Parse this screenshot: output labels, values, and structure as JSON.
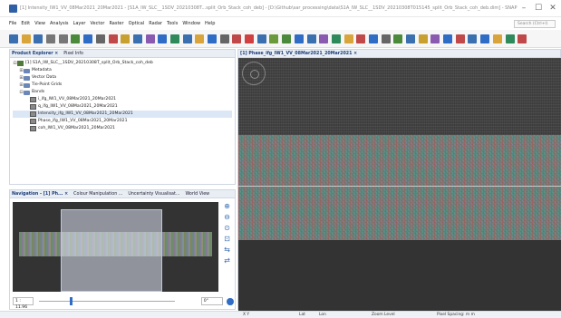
{
  "window": {
    "title": "[1] Intensity_IW1_VV_08Mar2021_20Mar2021 - [S1A_IW_SLC__1SDV_20210308T...split_Orb_Stack_coh_deb] - [D:\\Github\\sar_processing\\data\\S1A_IW_SLC__1SDV_20210308T015145_split_Orb_Stack_coh_deb.dim] - SNAP",
    "min": "–",
    "max": "☐",
    "close": "✕"
  },
  "menu": {
    "items": [
      "File",
      "Edit",
      "View",
      "Analysis",
      "Layer",
      "Vector",
      "Raster",
      "Optical",
      "Radar",
      "Tools",
      "Window",
      "Help"
    ],
    "search_placeholder": "Search (Ctrl+I)"
  },
  "toolbar": {
    "icons": [
      "new-product-icon",
      "open-icon",
      "save-icon",
      "undo-icon",
      "redo-icon",
      "zoom-tool-icon",
      "pan-tool-icon",
      "select-tool-icon",
      "range-finder-icon",
      "color-manip-icon",
      "layer-icon",
      "mask-icon",
      "histogram-icon",
      "scatter-icon",
      "profile-icon",
      "spectrum-icon",
      "info-icon",
      "statistics-icon",
      "gcp-icon",
      "pin-icon",
      "graph-builder-icon",
      "batch-icon",
      "band-maths-icon",
      "resample-icon",
      "subset-icon",
      "reprojection-icon",
      "mosaic-icon",
      "collocate-icon",
      "interferogram-icon",
      "coherence-icon",
      "deburst-icon",
      "terrain-icon",
      "snaphu-icon",
      "orbit-icon",
      "calibrate-icon",
      "speckle-icon",
      "polygon-icon",
      "line-icon",
      "rect-icon",
      "ellipse-icon",
      "world-map-icon",
      "help-icon"
    ],
    "icon_colors": [
      "#3a6fb0",
      "#d9a53b",
      "#3a6fb0",
      "#777",
      "#777",
      "#4a8a3a",
      "#2e6cc5",
      "#666",
      "#c04848",
      "#c8a030",
      "#3a6fb0",
      "#8a5ab0",
      "#2e6cc5",
      "#2e8a5a",
      "#3a6fb0",
      "#d9a53b",
      "#2e6cc5",
      "#666",
      "#c04848",
      "#d04040",
      "#3a6fb0",
      "#6a9a3a",
      "#4a8a3a",
      "#2e6cc5",
      "#3a6fb0",
      "#8a5ab0",
      "#2e8a5a",
      "#d9a53b",
      "#c04848",
      "#2e6cc5",
      "#666",
      "#4a8a3a",
      "#3a6fb0",
      "#c8a030",
      "#8a5ab0",
      "#2e6cc5",
      "#c04848",
      "#3a6fb0",
      "#2e6cc5",
      "#d9a53b",
      "#2e8a5a",
      "#c04848"
    ]
  },
  "product_explorer": {
    "tabs": [
      "Product Explorer ×",
      "Pixel Info"
    ],
    "tree": [
      {
        "label": "[1] S1A_IW_SLC__1SDV_20210308T_split_Orb_Stack_coh_deb",
        "type": "product",
        "exp": "⊟",
        "indent": 0
      },
      {
        "label": "Metadata",
        "type": "folder",
        "exp": "⊞",
        "indent": 1
      },
      {
        "label": "Vector Data",
        "type": "folder",
        "exp": "⊞",
        "indent": 1
      },
      {
        "label": "Tie-Point Grids",
        "type": "folder",
        "exp": "⊞",
        "indent": 1
      },
      {
        "label": "Bands",
        "type": "folder",
        "exp": "⊟",
        "indent": 1
      },
      {
        "label": "i_ifg_IW1_VV_08Mar2021_20Mar2021",
        "type": "band",
        "exp": "",
        "indent": 2
      },
      {
        "label": "q_ifg_IW1_VV_08Mar2021_20Mar2021",
        "type": "band",
        "exp": "",
        "indent": 2
      },
      {
        "label": "Intensity_ifg_IW1_VV_08Mar2021_20Mar2021",
        "type": "band",
        "exp": "",
        "indent": 2,
        "selected": true
      },
      {
        "label": "Phase_ifg_IW1_VV_08Mar2021_20Mar2021",
        "type": "band",
        "exp": "",
        "indent": 2
      },
      {
        "label": "coh_IW1_VV_08Mar2021_20Mar2021",
        "type": "band",
        "exp": "",
        "indent": 2
      }
    ]
  },
  "navigation": {
    "tabs": [
      "Navigation - [1] Ph... ×",
      "Colour Manipulation ...",
      "Uncertainty Visualisat...",
      "World View"
    ],
    "scale": "1 : 11.96",
    "angle": "0°",
    "zoom_level": 0.23,
    "tools": [
      "zoom-in-icon",
      "zoom-out-icon",
      "zoom-pixel-icon",
      "zoom-all-icon",
      "sync-views-icon",
      "sync-cursor-icon"
    ]
  },
  "image_view": {
    "tab": "[1] Phase_ifg_IW1_VV_08Mar2021_20Mar2021 ×"
  },
  "status": {
    "xy": "X    Y",
    "lat": "Lat",
    "lon": "Lon",
    "zoom": "Zoom    Level",
    "spacing": "Pixel Spacing:    m    m"
  }
}
